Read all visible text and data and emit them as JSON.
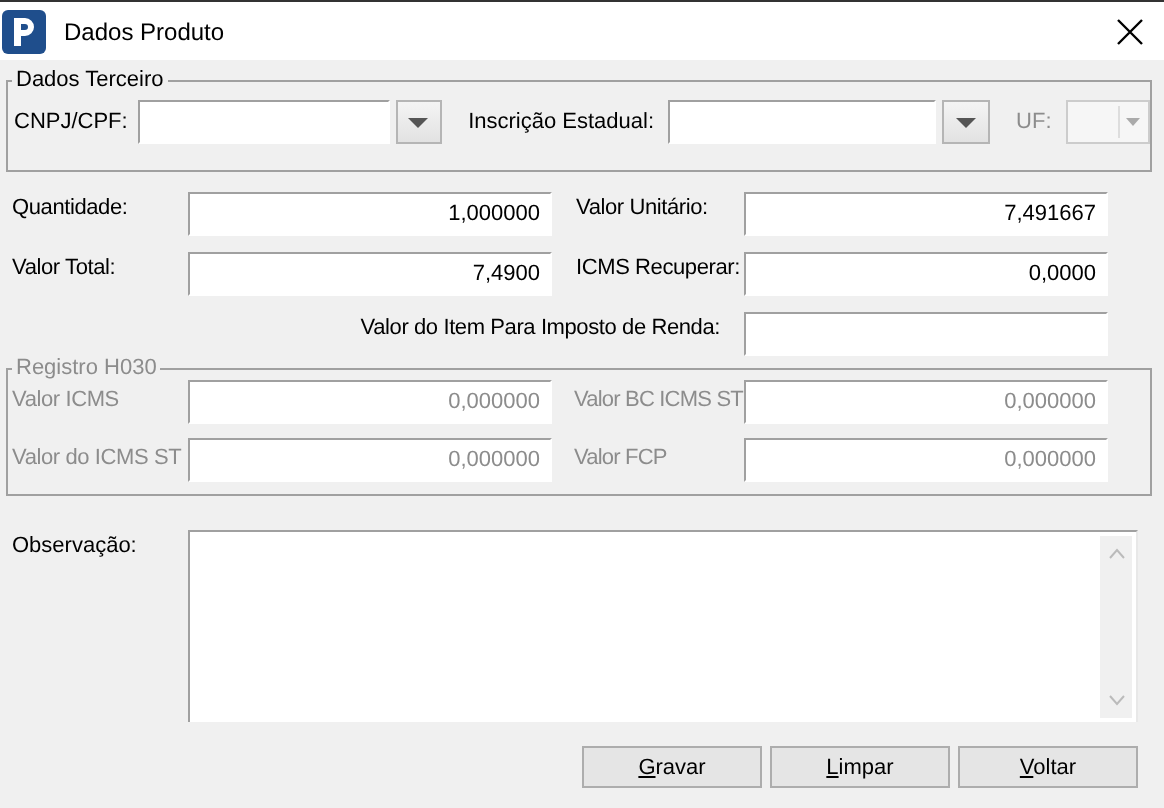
{
  "window": {
    "title": "Dados Produto"
  },
  "dados_terceiro": {
    "title": "Dados Terceiro",
    "fields": [
      {
        "label": "CNPJ/CPF:",
        "kind": "combo",
        "disabled": false
      },
      {
        "label": "Inscrição Estadual:",
        "kind": "combo",
        "disabled": false
      },
      {
        "label": "UF:",
        "kind": "small_combo",
        "disabled": true
      }
    ]
  },
  "values": [
    {
      "label": "Quantidade:",
      "value": "1,000000"
    },
    {
      "label": "Valor Unitário:",
      "value": "7,491667"
    },
    {
      "label": "Valor Total:",
      "value": "7,4900"
    },
    {
      "label": "ICMS Recuperar:",
      "value": "0,0000"
    }
  ],
  "imposto_renda": {
    "label": "Valor do Item Para Imposto de Renda:"
  },
  "registro_h030": {
    "title": "Registro H030",
    "disabled": true,
    "fields": [
      {
        "label": "Valor ICMS",
        "value": "0,000000"
      },
      {
        "label": "Valor BC ICMS ST",
        "value": "0,000000"
      },
      {
        "label": "Valor do ICMS ST",
        "value": "0,000000"
      },
      {
        "label": "Valor FCP",
        "value": "0,000000"
      }
    ]
  },
  "observacao": {
    "label": "Observação:"
  },
  "buttons": [
    {
      "label": "Gravar",
      "access_key_underlined": true
    },
    {
      "label": "Limpar",
      "access_key_underlined": true
    },
    {
      "label": "Voltar",
      "access_key_underlined": true
    }
  ]
}
